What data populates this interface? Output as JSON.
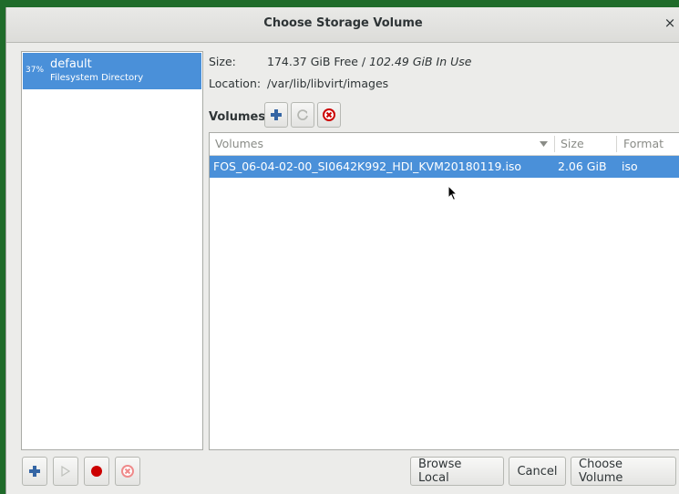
{
  "window": {
    "title": "Choose Storage Volume",
    "close_glyph": "×"
  },
  "pool": {
    "percent": "37%",
    "name": "default",
    "type": "Filesystem Directory"
  },
  "info": {
    "size_label": "Size:",
    "size_free": "174.37 GiB Free / ",
    "size_inuse": "102.49 GiB In Use",
    "location_label": "Location:",
    "location_value": "/var/lib/libvirt/images"
  },
  "volumes_toolbar": {
    "label": "Volumes",
    "icons": [
      "add-icon",
      "refresh-icon",
      "delete-icon"
    ]
  },
  "volumes_table": {
    "columns": [
      "Volumes",
      "Size",
      "Format"
    ],
    "rows": [
      {
        "name": "FOS_06-04-02-00_SI0642K992_HDI_KVM20180119.iso",
        "size": "2.06 GiB",
        "format": "iso"
      }
    ]
  },
  "pool_actions": {
    "icons": [
      "add-pool-icon",
      "start-pool-icon",
      "stop-pool-icon",
      "delete-pool-icon"
    ]
  },
  "buttons": {
    "browse_local": "Browse Local",
    "cancel": "Cancel",
    "choose_volume": "Choose Volume"
  },
  "colors": {
    "selection": "#4a90d9",
    "delete_red": "#cc0000",
    "add_blue": "#3465a4"
  }
}
